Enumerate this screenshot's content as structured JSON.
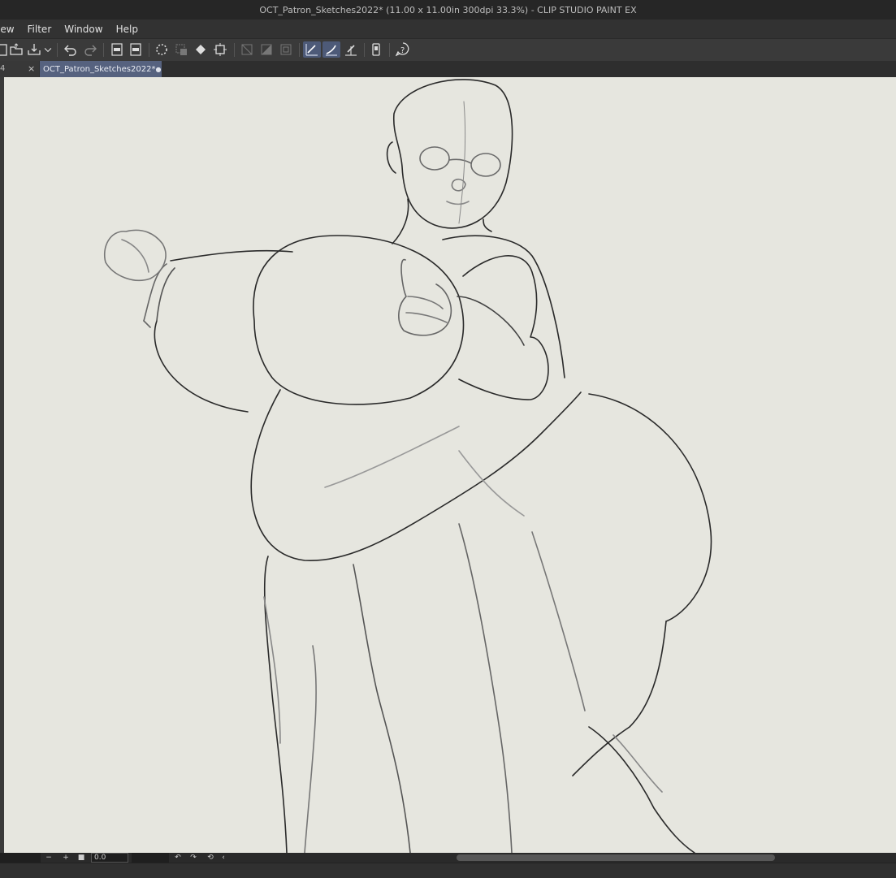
{
  "window": {
    "title": "OCT_Patron_Sketches2022* (11.00 x 11.00in 300dpi 33.3%)  - CLIP STUDIO PAINT EX"
  },
  "menu": {
    "items": [
      "iew",
      "Filter",
      "Window",
      "Help"
    ]
  },
  "toolbar": {
    "buttons": [
      {
        "name": "new-canvas-icon",
        "active": false
      },
      {
        "name": "open-folder-icon",
        "active": false
      },
      {
        "name": "save-icon",
        "active": false
      },
      {
        "name": "chevron-down-icon",
        "active": false
      },
      {
        "name": "undo-icon",
        "active": false
      },
      {
        "name": "redo-icon",
        "active": false
      },
      {
        "name": "export-png-icon",
        "active": false
      },
      {
        "name": "export-psd-icon",
        "active": false
      },
      {
        "name": "loading-icon",
        "active": false
      },
      {
        "name": "clear-selection-icon",
        "active": false
      },
      {
        "name": "fill-icon",
        "active": false
      },
      {
        "name": "transform-icon",
        "active": false
      },
      {
        "name": "invert-selection-icon",
        "active": false
      },
      {
        "name": "gradient-selection-icon",
        "active": false
      },
      {
        "name": "border-selection-icon",
        "active": false
      },
      {
        "name": "snap-to-ruler-icon",
        "active": true
      },
      {
        "name": "snap-to-special-ruler-icon",
        "active": true
      },
      {
        "name": "snap-to-grid-icon",
        "active": false
      },
      {
        "name": "smartphone-icon",
        "active": false
      },
      {
        "name": "help-icon",
        "active": false
      }
    ]
  },
  "tabs": {
    "previous": {
      "number": "4",
      "close": "×"
    },
    "current": {
      "label": "OCT_Patron_Sketches2022*",
      "modified_mark": "●"
    }
  },
  "status": {
    "zoom_minus": "−",
    "zoom_plus": "+",
    "stop": "■",
    "zoom_value": "0.0",
    "rotate_left": "↶",
    "rotate_right": "↷",
    "reset": "⟲",
    "collapse": "‹"
  },
  "colors": {
    "canvas": "#e6e6df",
    "active_tab": "#56627f",
    "active_toggle": "#4d5a78"
  }
}
